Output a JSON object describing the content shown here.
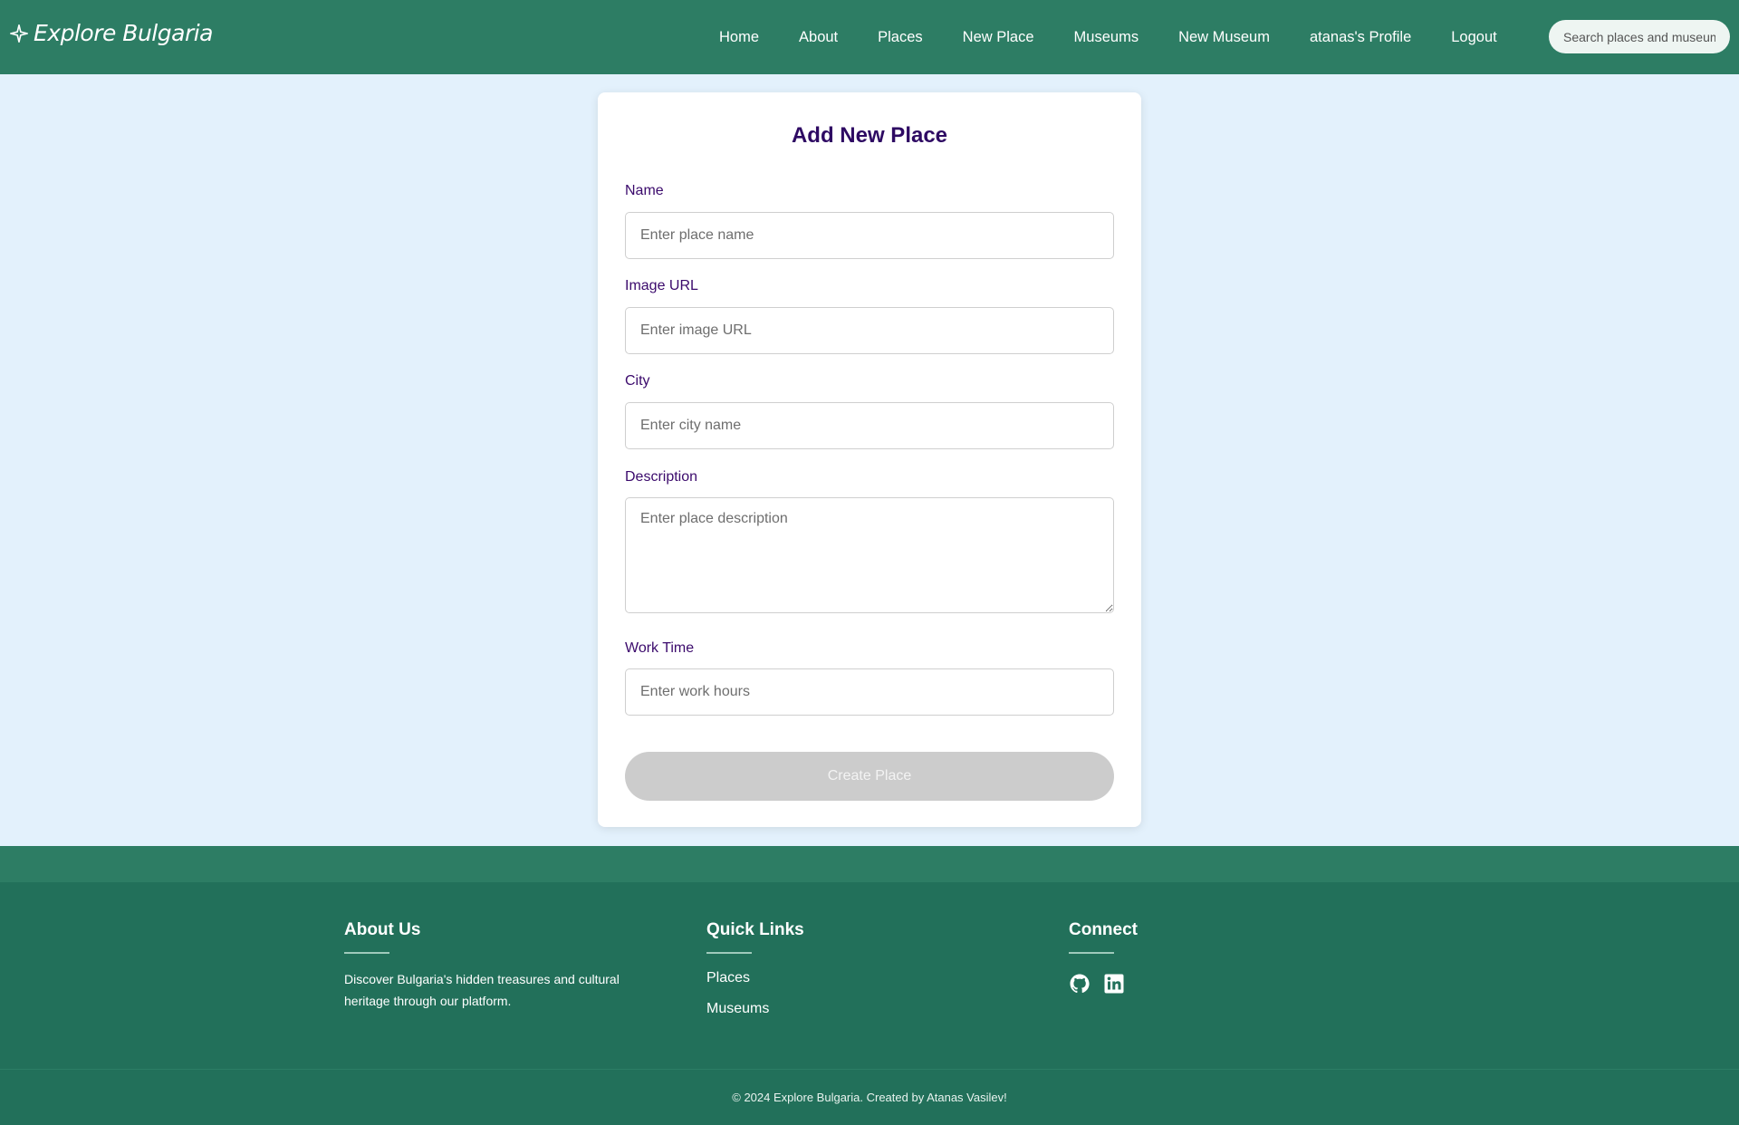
{
  "header": {
    "brand": "Explore Bulgaria",
    "nav": [
      {
        "label": "Home"
      },
      {
        "label": "About"
      },
      {
        "label": "Places"
      },
      {
        "label": "New Place"
      },
      {
        "label": "Museums"
      },
      {
        "label": "New Museum"
      },
      {
        "label": "atanas's Profile"
      },
      {
        "label": "Logout"
      }
    ],
    "search_placeholder": "Search places and museums..."
  },
  "form": {
    "title": "Add New Place",
    "fields": [
      {
        "label": "Name",
        "placeholder": "Enter place name",
        "value": ""
      },
      {
        "label": "Image URL",
        "placeholder": "Enter image URL",
        "value": ""
      },
      {
        "label": "City",
        "placeholder": "Enter city name",
        "value": ""
      },
      {
        "label": "Description",
        "placeholder": "Enter place description",
        "value": ""
      },
      {
        "label": "Work Time",
        "placeholder": "Enter work hours",
        "value": ""
      }
    ],
    "submit_label": "Create Place"
  },
  "footer": {
    "about": {
      "heading": "About Us",
      "text": "Discover Bulgaria's hidden treasures and cultural heritage through our platform."
    },
    "quick_links": {
      "heading": "Quick Links",
      "links": [
        {
          "label": "Places"
        },
        {
          "label": "Museums"
        }
      ]
    },
    "connect": {
      "heading": "Connect",
      "icons": [
        "github-icon",
        "linkedin-icon"
      ]
    },
    "copyright": "© 2024 Explore Bulgaria. Created by Atanas Vasilev!"
  },
  "colors": {
    "header_bg": "#2d7d64",
    "page_bg": "#e3f1fc",
    "title_color": "#2e0a63",
    "label_color": "#3b0a6c",
    "button_disabled": "#cccccc",
    "footer_bg": "#22705a"
  }
}
